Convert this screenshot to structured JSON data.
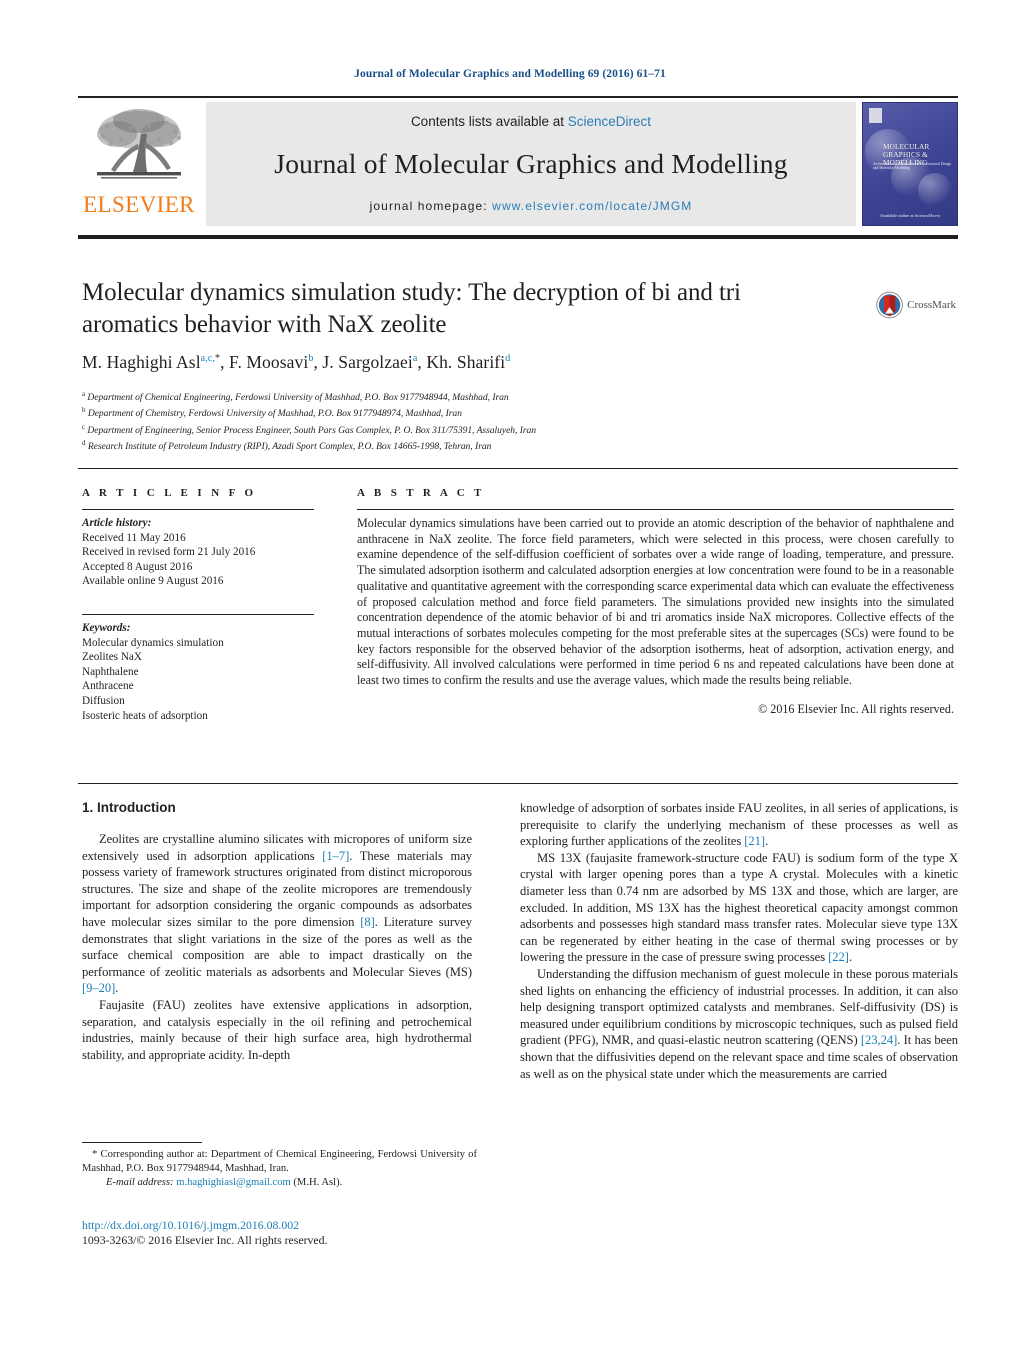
{
  "running_head": "Journal of Molecular Graphics and Modelling 69 (2016) 61–71",
  "masthead": {
    "publisher": "ELSEVIER",
    "contents_prefix": "Contents lists available at ",
    "contents_link": "ScienceDirect",
    "journal_name": "Journal of Molecular Graphics and Modelling",
    "homepage_prefix": "journal homepage: ",
    "homepage_url": "www.elsevier.com/locate/JMGM",
    "cover": {
      "title": "MOLECULAR GRAPHICS & MODELLING",
      "subtitle": "An International Journal Devoted to Structural Design and Molecular Modelling",
      "footer": "Available online at ScienceDirect",
      "bg_color": "#3d4292"
    },
    "link_color": "#2b7cb5",
    "elsevier_color": "#ef7d1a"
  },
  "title": {
    "line1": "Molecular dynamics simulation study: The decryption of bi and tri",
    "line2": "aromatics behavior with NaX zeolite",
    "crossmark_label": "CrossMark"
  },
  "authors": {
    "list": [
      {
        "name": "M. Haghighi Asl",
        "marks": "a,c,",
        "star": "*"
      },
      {
        "name": "F. Moosavi",
        "marks": "b",
        "star": ""
      },
      {
        "name": "J. Sargolzaei",
        "marks": "a",
        "star": ""
      },
      {
        "name": "Kh. Sharifi",
        "marks": "d",
        "star": ""
      }
    ],
    "affiliations": [
      {
        "mark": "a",
        "text": "Department of Chemical Engineering, Ferdowsi University of Mashhad, P.O. Box 9177948944, Mashhad, Iran"
      },
      {
        "mark": "b",
        "text": "Department of Chemistry, Ferdowsi University of Mashhad, P.O. Box 9177948974, Mashhad, Iran"
      },
      {
        "mark": "c",
        "text": "Department of Engineering, Senior Process Engineer, South Pars Gas Complex, P. O. Box 311/75391, Assaluyeh, Iran"
      },
      {
        "mark": "d",
        "text": "Research Institute of Petroleum Industry (RIPI), Azadi Sport Complex, P.O. Box 14665-1998, Tehran, Iran"
      }
    ]
  },
  "article_info": {
    "heading": "A R T I C L E   I N F O",
    "history_label": "Article history:",
    "history": [
      "Received 11 May 2016",
      "Received in revised form 21 July 2016",
      "Accepted 8 August 2016",
      "Available online 9 August 2016"
    ],
    "keywords_label": "Keywords:",
    "keywords": [
      "Molecular dynamics simulation",
      "Zeolites NaX",
      "Naphthalene",
      "Anthracene",
      "Diffusion",
      "Isosteric heats of adsorption"
    ]
  },
  "abstract": {
    "heading": "A B S T R A C T",
    "body": "Molecular dynamics simulations have been carried out to provide an atomic description of the behavior of naphthalene and anthracene in NaX zeolite. The force field parameters, which were selected in this process, were chosen carefully to examine dependence of the self-diffusion coefficient of sorbates over a wide range of loading, temperature, and pressure. The simulated adsorption isotherm and calculated adsorption energies at low concentration were found to be in a reasonable qualitative and quantitative agreement with the corresponding scarce experimental data which can evaluate the effectiveness of proposed calculation method and force field parameters. The simulations provided new insights into the simulated concentration dependence of the atomic behavior of bi and tri aromatics inside NaX micropores. Collective effects of the mutual interactions of sorbates molecules competing for the most preferable sites at the supercages (SCs) were found to be key factors responsible for the observed behavior of the adsorption isotherms, heat of adsorption, activation energy, and self-diffusivity. All involved calculations were performed in time period 6 ns and repeated calculations have been done at least two times to confirm the results and use the average values, which made the results being reliable.",
    "copyright": "© 2016 Elsevier Inc. All rights reserved."
  },
  "body": {
    "section_heading": "1.  Introduction",
    "left_paragraphs": [
      "Zeolites are crystalline alumino silicates with micropores of uniform size extensively used in adsorption applications [1–7]. These materials may possess variety of framework structures originated from distinct microporous structures. The size and shape of the zeolite micropores are tremendously important for adsorption considering the organic compounds as adsorbates have molecular sizes similar to the pore dimension [8]. Literature survey demonstrates that slight variations in the size of the pores as well as the surface chemical composition are able to impact drastically on the performance of zeolitic materials as adsorbents and Molecular Sieves (MS) [9–20].",
      "Faujasite (FAU) zeolites have extensive applications in adsorption, separation, and catalysis especially in the oil refining and petrochemical industries, mainly because of their high surface area, high hydrothermal stability, and appropriate acidity. In-depth"
    ],
    "right_paragraphs": [
      "knowledge of adsorption of sorbates inside FAU zeolites, in all series of applications, is prerequisite to clarify the underlying mechanism of these processes as well as exploring further applications of the zeolites [21].",
      "MS 13X (faujasite framework-structure code FAU) is sodium form of the type X crystal with larger opening pores than a type A crystal. Molecules with a kinetic diameter less than 0.74 nm are adsorbed by MS 13X and those, which are larger, are excluded. In addition, MS 13X has the highest theoretical capacity amongst common adsorbents and possesses high standard mass transfer rates. Molecular sieve type 13X can be regenerated by either heating in the case of thermal swing processes or by lowering the pressure in the case of pressure swing processes [22].",
      "Understanding the diffusion mechanism of guest molecule in these porous materials shed lights on enhancing the efficiency of industrial processes. In addition, it can also help designing transport optimized catalysts and membranes. Self-diffusivity (DS) is measured under equilibrium conditions by microscopic techniques, such as pulsed field gradient (PFG), NMR, and quasi-elastic neutron scattering (QENS) [23,24]. It has been shown that the diffusivities depend on the relevant space and time scales of observation as well as on the physical state under which the measurements are carried"
    ]
  },
  "footnote": {
    "corresponding": "* Corresponding author at: Department of Chemical Engineering, Ferdowsi University of Mashhad, P.O. Box 9177948944, Mashhad, Iran.",
    "email_label": "E-mail address:",
    "email": "m.haghighiasl@gmail.com",
    "email_owner": "(M.H. Asl)."
  },
  "doi": {
    "url": "http://dx.doi.org/10.1016/j.jmgm.2016.08.002",
    "issn_line": "1093-3263/© 2016 Elsevier Inc. All rights reserved."
  }
}
